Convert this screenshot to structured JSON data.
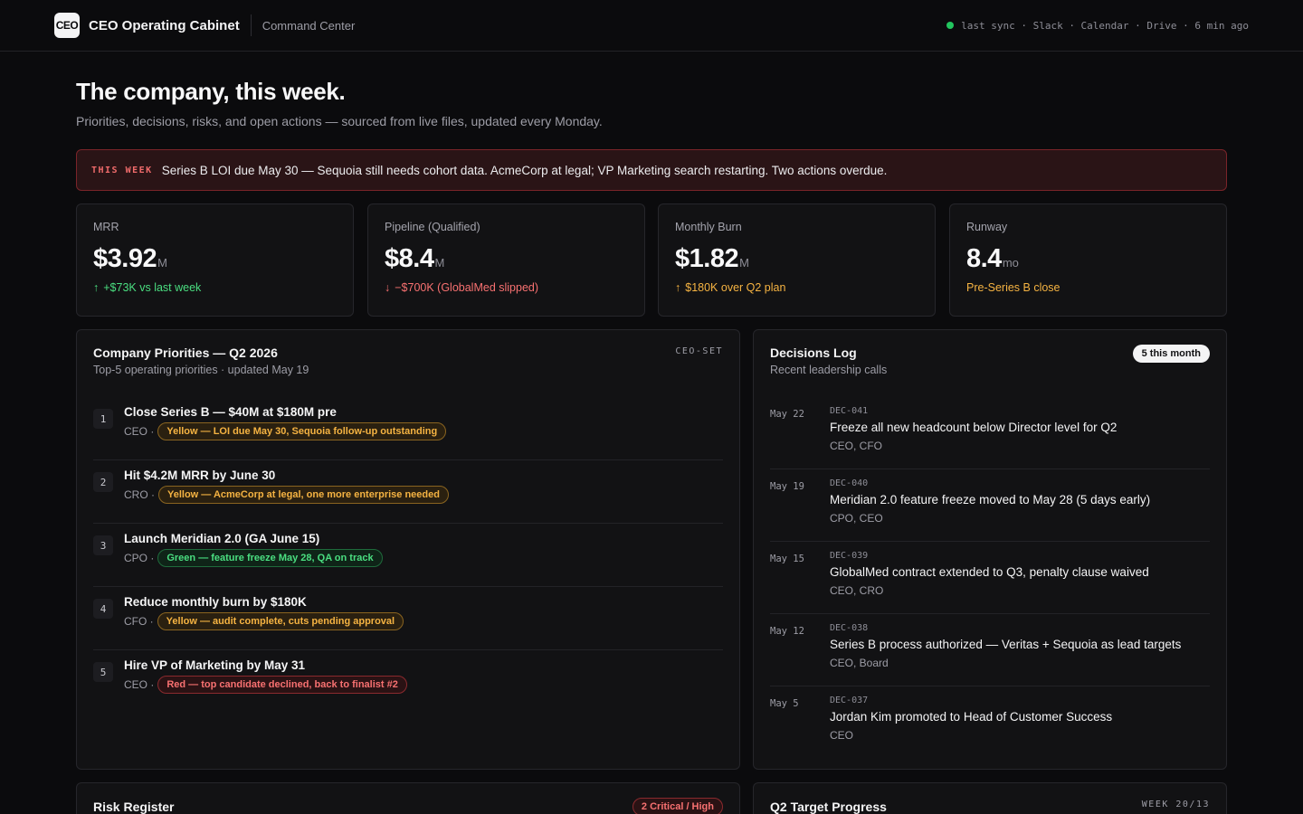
{
  "header": {
    "logo": "CEO",
    "brand": "CEO Operating Cabinet",
    "section": "Command Center",
    "sync": "last sync · Slack · Calendar · Drive · 6 min ago",
    "sync_color": "#22c55e"
  },
  "hero": {
    "title": "The company, this week.",
    "subtitle": "Priorities, decisions, risks, and open actions — sourced from live files, updated every Monday."
  },
  "alert": {
    "tag": "THIS WEEK",
    "text": "Series B LOI due May 30 — Sequoia still needs cohort data. AcmeCorp at legal; VP Marketing search restarting. Two actions overdue."
  },
  "kpis": [
    {
      "label": "MRR",
      "value": "$3.92",
      "unit": "M",
      "arrow": "↑",
      "delta": "+$73K vs last week",
      "tone": "green"
    },
    {
      "label": "Pipeline (Qualified)",
      "value": "$8.4",
      "unit": "M",
      "arrow": "↓",
      "delta": "−$700K (GlobalMed slipped)",
      "tone": "red"
    },
    {
      "label": "Monthly Burn",
      "value": "$1.82",
      "unit": "M",
      "arrow": "↑",
      "delta": "$180K over Q2 plan",
      "tone": "amber"
    },
    {
      "label": "Runway",
      "value": "8.4",
      "unit": "mo",
      "arrow": "",
      "delta": "Pre-Series B close",
      "tone": "amber"
    }
  ],
  "priorities": {
    "title": "Company Priorities — Q2 2026",
    "subtitle": "Top-5 operating priorities · updated May 19",
    "tag": "CEO-SET",
    "items": [
      {
        "num": "1",
        "title": "Close Series B — $40M at $180M pre",
        "owner": "CEO ·",
        "status": "Yellow — LOI due May 30, Sequoia follow-up outstanding",
        "tone": "yellow"
      },
      {
        "num": "2",
        "title": "Hit $4.2M MRR by June 30",
        "owner": "CRO ·",
        "status": "Yellow — AcmeCorp at legal, one more enterprise needed",
        "tone": "yellow"
      },
      {
        "num": "3",
        "title": "Launch Meridian 2.0 (GA June 15)",
        "owner": "CPO ·",
        "status": "Green — feature freeze May 28, QA on track",
        "tone": "green"
      },
      {
        "num": "4",
        "title": "Reduce monthly burn by $180K",
        "owner": "CFO ·",
        "status": "Yellow — audit complete, cuts pending approval",
        "tone": "yellow"
      },
      {
        "num": "5",
        "title": "Hire VP of Marketing by May 31",
        "owner": "CEO ·",
        "status": "Red — top candidate declined, back to finalist #2",
        "tone": "red"
      }
    ]
  },
  "decisions": {
    "title": "Decisions Log",
    "subtitle": "Recent leadership calls",
    "badge": "5 this month",
    "items": [
      {
        "date": "May 22",
        "id": "DEC-041",
        "title": "Freeze all new headcount below Director level for Q2",
        "owner": "CEO, CFO"
      },
      {
        "date": "May 19",
        "id": "DEC-040",
        "title": "Meridian 2.0 feature freeze moved to May 28 (5 days early)",
        "owner": "CPO, CEO"
      },
      {
        "date": "May 15",
        "id": "DEC-039",
        "title": "GlobalMed contract extended to Q3, penalty clause waived",
        "owner": "CEO, CRO"
      },
      {
        "date": "May 12",
        "id": "DEC-038",
        "title": "Series B process authorized — Veritas + Sequoia as lead targets",
        "owner": "CEO, Board"
      },
      {
        "date": "May 5",
        "id": "DEC-037",
        "title": "Jordan Kim promoted to Head of Customer Success",
        "owner": "CEO"
      }
    ]
  },
  "risk": {
    "title": "Risk Register",
    "badge": "2 Critical / High"
  },
  "targets": {
    "title": "Q2 Target Progress",
    "tag": "WEEK 20/13"
  }
}
